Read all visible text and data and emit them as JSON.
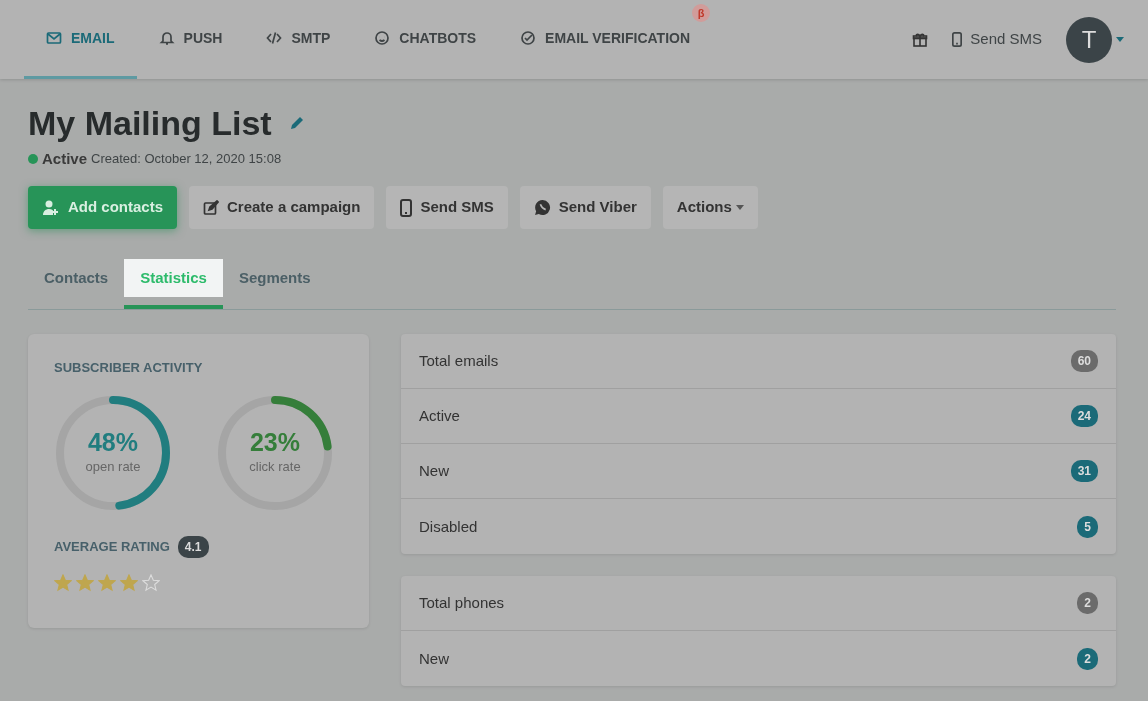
{
  "nav": {
    "items": [
      {
        "label": "EMAIL",
        "selected": true
      },
      {
        "label": "PUSH",
        "selected": false
      },
      {
        "label": "SMTP",
        "selected": false
      },
      {
        "label": "CHATBOTS",
        "selected": false
      },
      {
        "label": "EMAIL VERIFICATION",
        "selected": false,
        "badge": "β"
      }
    ],
    "send_sms": "Send SMS",
    "avatar": "T"
  },
  "page": {
    "title": "My Mailing List",
    "status": "Active",
    "created": "Created: October 12, 2020 15:08"
  },
  "actions": [
    {
      "label": "Add contacts",
      "kind": "primary"
    },
    {
      "label": "Create a campaign",
      "kind": "secondary"
    },
    {
      "label": "Send SMS",
      "kind": "secondary"
    },
    {
      "label": "Send Viber",
      "kind": "secondary"
    },
    {
      "label": "Actions",
      "kind": "dropdown"
    }
  ],
  "tabs": [
    {
      "label": "Contacts",
      "selected": false
    },
    {
      "label": "Statistics",
      "selected": true
    },
    {
      "label": "Segments",
      "selected": false
    }
  ],
  "activity": {
    "title": "SUBSCRIBER ACTIVITY",
    "rings": [
      {
        "value": "48%",
        "caption": "open rate",
        "level": 0.48,
        "color": "#217d7f"
      },
      {
        "value": "23%",
        "caption": "click rate",
        "level": 0.23,
        "color": "#357e3a"
      }
    ],
    "rating_label": "AVERAGE RATING",
    "rating": "4.1",
    "stars": 4
  },
  "email_stats": [
    {
      "label": "Total emails",
      "count": "60",
      "color": "#6b6b6b"
    },
    {
      "label": "Active",
      "count": "24",
      "color": "#1b6a78"
    },
    {
      "label": "New",
      "count": "31",
      "color": "#1b6a78"
    },
    {
      "label": "Disabled",
      "count": "5",
      "color": "#1b6a78"
    }
  ],
  "phone_stats": [
    {
      "label": "Total phones",
      "count": "2",
      "color": "#6b6b6b"
    },
    {
      "label": "New",
      "count": "2",
      "color": "#1b6a78"
    }
  ]
}
